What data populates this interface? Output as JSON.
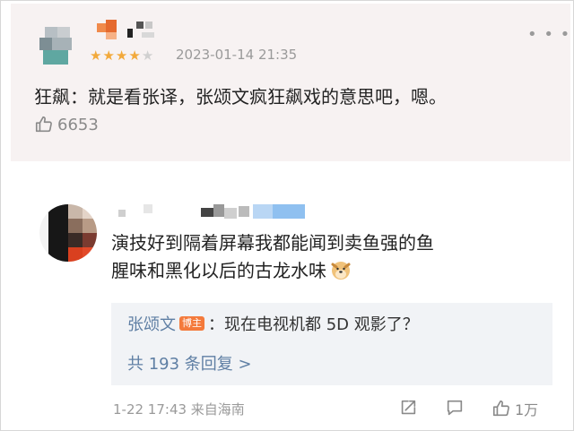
{
  "review": {
    "rating_value": 4,
    "rating_max": 5,
    "date": "2023-01-14 21:35",
    "more_icon": "more-icon",
    "text": "狂飙：就是看张译，张颂文疯狂飙戏的意思吧，嗯。",
    "like_count": "6653",
    "colors": {
      "star_on": "#f2a93b",
      "star_off": "#d0d0d0",
      "card_bg": "#f7f2f2"
    }
  },
  "comment": {
    "text_line1": "演技好到隔着屏幕我都能闻到卖鱼强的鱼",
    "text_line2": "腥味和黑化以后的古龙水味",
    "emoji_icon": "doge-emoji-icon",
    "reply": {
      "author": "张颂文",
      "badge": "博主",
      "text": "：现在电视机都 5D 观影了？",
      "count_label": "共 193 条回复 >"
    },
    "meta": "1-22 17:43  来自海南",
    "like_count": "1万",
    "colors": {
      "link": "#5f7fa4",
      "reply_bg": "#f1f3f6",
      "badge": "#f47a3b"
    }
  }
}
